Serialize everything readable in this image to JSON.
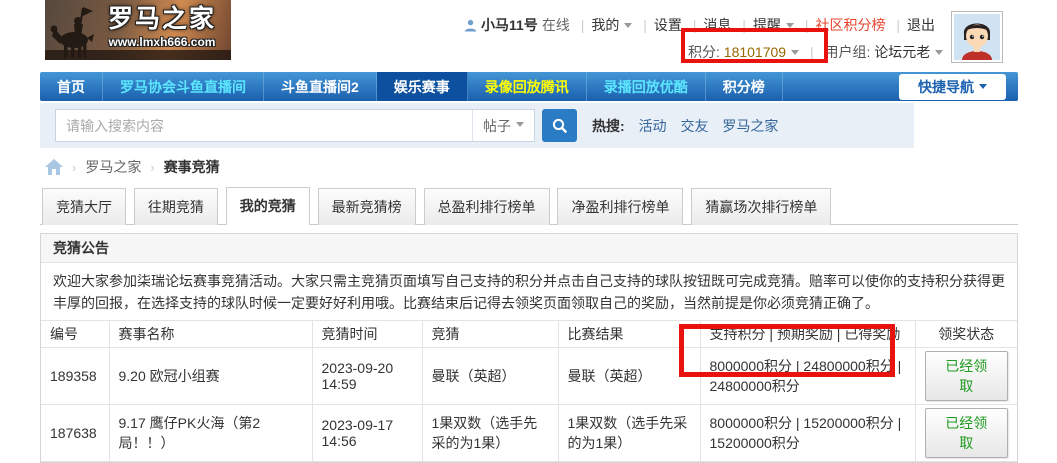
{
  "colors": {
    "nav_bg_top": "#4496d6",
    "nav_bg_bottom": "#1a5fae",
    "nav_active_bg": "#0d509f",
    "nav_link_cyan": "#5ce6ff",
    "nav_link_yellow": "#ffff00",
    "highlight_red": "#e8120f",
    "hot_link_blue": "#336699",
    "status_green": "#1e9a1e",
    "community_rank_red": "#e8432e"
  },
  "logo": {
    "title": "罗马之家",
    "subtitle": "www.lmxh666.com"
  },
  "userbar": {
    "username": "小马11号",
    "online": "在线",
    "my": "我的",
    "settings": "设置",
    "messages": "消息",
    "reminders": "提醒",
    "community_rank": "社区积分榜",
    "logout": "退出",
    "credit_label": "积分:",
    "credit_value": "18101709",
    "group_label": "用户组:",
    "group_value": "论坛元老"
  },
  "nav": {
    "items": [
      "首页",
      "罗马协会斗鱼直播间",
      "斗鱼直播间2",
      "娱乐赛事",
      "录像回放腾讯",
      "录播回放优酷",
      "积分榜"
    ],
    "active_item": "娱乐赛事",
    "quick_nav": "快捷导航"
  },
  "search": {
    "placeholder": "请输入搜索内容",
    "type": "帖子",
    "hot_label": "热搜:",
    "hot_links": [
      "活动",
      "交友",
      "罗马之家"
    ]
  },
  "breadcrumb": {
    "items": [
      "罗马之家",
      "赛事竞猜"
    ]
  },
  "tabs": {
    "items": [
      "竞猜大厅",
      "往期竞猜",
      "我的竞猜",
      "最新竞猜榜",
      "总盈利排行榜单",
      "净盈利排行榜单",
      "猜赢场次排行榜单"
    ],
    "active": "我的竞猜"
  },
  "announcement": {
    "title": "竞猜公告",
    "body": "欢迎大家参加柒瑞论坛赛事竞猜活动。大家只需主竞猜页面填写自己支持的积分并点击自己支持的球队按钮既可完成竞猜。赔率可以使你的支持积分获得更丰厚的回报，在选择支持的球队时候一定要好好利用哦。比赛结束后记得去领奖页面领取自己的奖励，当然前提是你必须竞猜正确了。"
  },
  "table": {
    "headers": [
      "编号",
      "赛事名称",
      "竞猜时间",
      "竞猜",
      "比赛结果",
      "支持积分 | 预期奖励 | 已得奖励",
      "领奖状态"
    ],
    "rows": [
      {
        "id": "189358",
        "event": "9.20 欧冠小组赛",
        "time": "2023-09-20 14:59",
        "guess": "曼联（英超）",
        "result": "曼联（英超）",
        "points": "8000000积分 | 24800000积分 | 24800000积分",
        "status": "已经领取"
      },
      {
        "id": "187638",
        "event": "9.17 鹰仔PK火海（第2局！！）",
        "time": "2023-09-17 14:56",
        "guess": "1果双数（选手先采的为1果）",
        "result": "1果双数（选手先采的为1果）",
        "points": "8000000积分 | 15200000积分 | 15200000积分",
        "status": "已经领取"
      }
    ]
  }
}
